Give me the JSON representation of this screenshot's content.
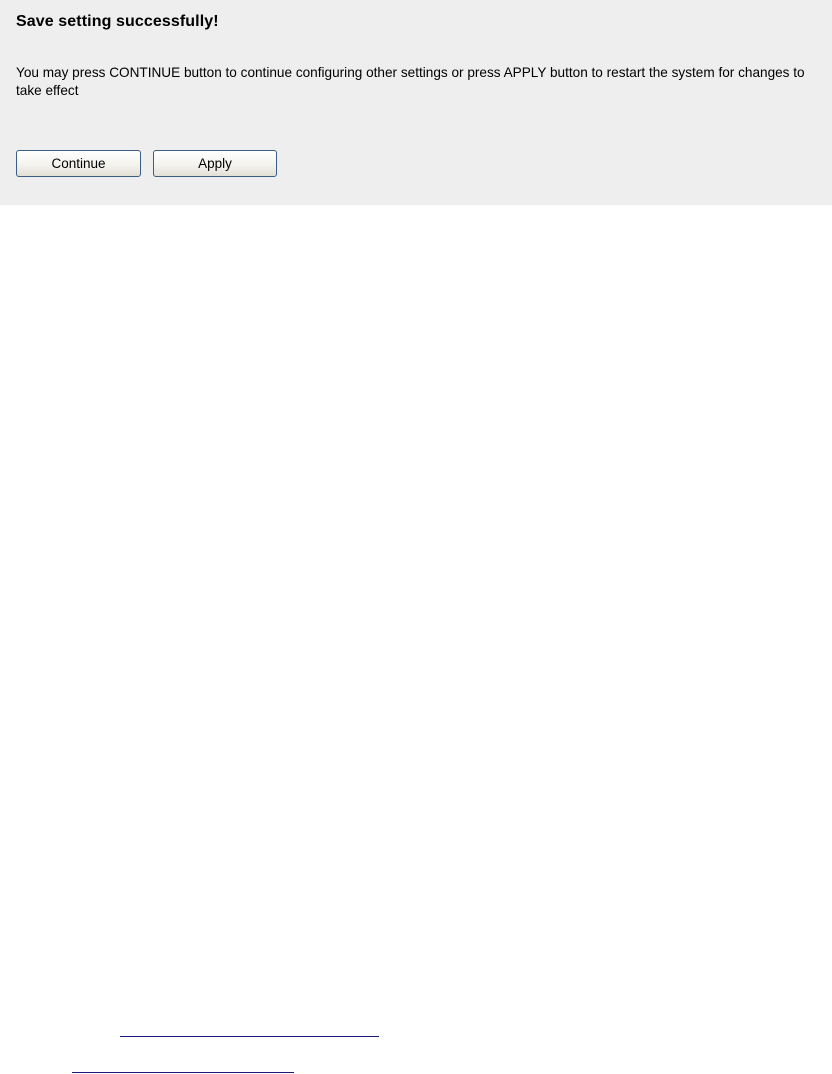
{
  "dialog": {
    "title": "Save setting successfully!",
    "message": "You may press CONTINUE button to continue configuring other settings or press APPLY button to restart the system for changes to take effect",
    "continue_label": "Continue",
    "apply_label": "Apply"
  },
  "colors": {
    "panel_background": "#eeeeee",
    "page_background": "#ffffff",
    "button_border": "#3c5e85",
    "link_underline": "#1a1a7a"
  }
}
